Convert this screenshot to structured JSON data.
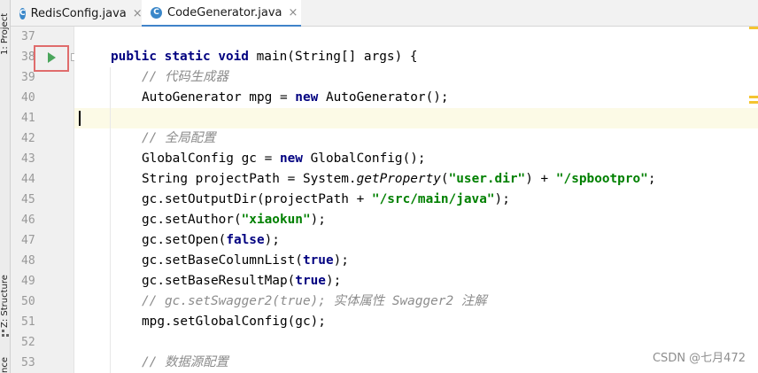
{
  "left_strip": {
    "project_label": "1: Project",
    "structure_label": "Z: Structure",
    "bottom_label": "nce"
  },
  "tabs": [
    {
      "label": "RedisConfig.java",
      "icon": "class-icon",
      "close": "×"
    },
    {
      "label": "CodeGenerator.java",
      "icon": "class-icon",
      "close": "×"
    }
  ],
  "editor": {
    "line_numbers": [
      "37",
      "38",
      "39",
      "40",
      "41",
      "42",
      "43",
      "44",
      "45",
      "46",
      "47",
      "48",
      "49",
      "50",
      "51",
      "52",
      "53"
    ],
    "code": {
      "l38_a": "public",
      "l38_b": "static",
      "l38_c": "void",
      "l38_d": "main(String[] args) {",
      "l39": "// 代码生成器",
      "l40_a": "AutoGenerator mpg = ",
      "l40_b": "new",
      "l40_c": " AutoGenerator();",
      "l42": "// 全局配置",
      "l43_a": "GlobalConfig gc = ",
      "l43_b": "new",
      "l43_c": " GlobalConfig();",
      "l44_a": "String projectPath = System.",
      "l44_b": "getProperty",
      "l44_c": "(",
      "l44_d": "\"user.dir\"",
      "l44_e": ") + ",
      "l44_f": "\"/spbootpro\"",
      "l44_g": ";",
      "l45_a": "gc.setOutputDir(projectPath + ",
      "l45_b": "\"/src/main/java\"",
      "l45_c": ");",
      "l46_a": "gc.setAuthor(",
      "l46_b": "\"xiaokun\"",
      "l46_c": ");",
      "l47_a": "gc.setOpen(",
      "l47_b": "false",
      "l47_c": ");",
      "l48_a": "gc.setBaseColumnList(",
      "l48_b": "true",
      "l48_c": ");",
      "l49_a": "gc.setBaseResultMap(",
      "l49_b": "true",
      "l49_c": ");",
      "l50": "// gc.setSwagger2(true); 实体属性 Swagger2 注解",
      "l51": "mpg.setGlobalConfig(gc);",
      "l53": "// 数据源配置"
    }
  },
  "watermark": "CSDN @七月472",
  "colors": {
    "keyword": "#000080",
    "string": "#008000",
    "comment": "#8c8c8c",
    "run_icon": "#4aa55b",
    "highlight_box": "#e06c6c"
  }
}
